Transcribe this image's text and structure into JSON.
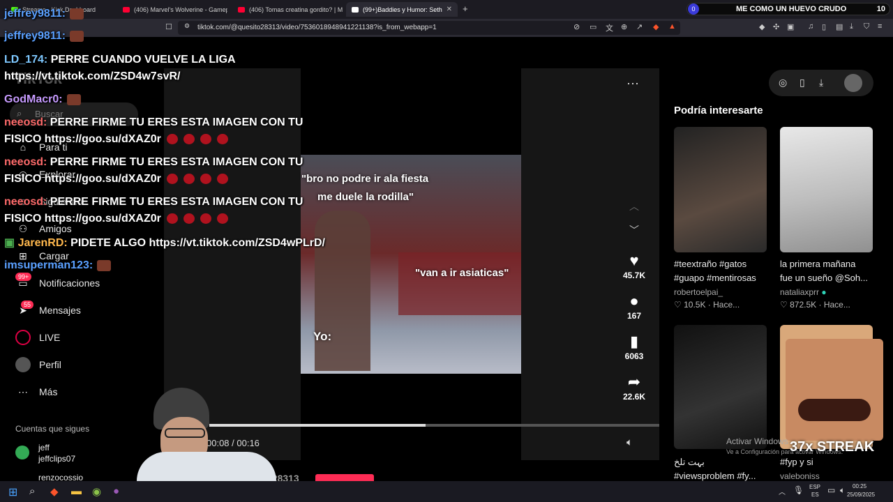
{
  "tabs": [
    {
      "label": "Streams - Kick Dashboard",
      "color": "#53fc18"
    },
    {
      "label": "(406) Marvel's Wolverine - Gameplay",
      "color": "#ff0033"
    },
    {
      "label": "(406) Tomas creatina gordito? | Mom",
      "color": "#ff0033"
    },
    {
      "label": "(99+)Baddies y Humor: Seth F",
      "color": "#ffffff"
    }
  ],
  "new_tab": "+",
  "brave_pill": {
    "count": "0",
    "label": "ME COMO UN HUEVO CRUDO",
    "number": "10"
  },
  "url": "tiktok.com/@quesito28313/video/7536018948941221138?is_from_webapp=1",
  "chat": [
    {
      "user": "jeffrey9811:",
      "color": "#5aa0ff",
      "text": ""
    },
    {
      "user": "jeffrey9811:",
      "color": "#5aa0ff",
      "text": ""
    },
    {
      "user": "LD_174:",
      "color": "#7ec8ff",
      "text": "PERRE CUANDO VUELVE LA LIGA"
    },
    {
      "user": "",
      "color": "#ffffff",
      "text": "https://vt.tiktok.com/ZSD4w7svR/"
    },
    {
      "user": "GodMacr0:",
      "color": "#c79bff",
      "text": ""
    },
    {
      "user": "neeosd:",
      "color": "#ff6b6b",
      "text": "PERRE FIRME TU ERES ESTA IMAGEN CON TU"
    },
    {
      "user": "",
      "color": "#ffffff",
      "text": "FISICO https://goo.su/dXAZ0r"
    },
    {
      "user": "neeosd:",
      "color": "#ff6b6b",
      "text": "PERRE FIRME TU ERES ESTA IMAGEN CON TU"
    },
    {
      "user": "",
      "color": "#ffffff",
      "text": "FISICO https://goo.su/dXAZ0r"
    },
    {
      "user": "neeosd:",
      "color": "#ff6b6b",
      "text": "PERRE FIRME TU ERES ESTA IMAGEN CON TU"
    },
    {
      "user": "",
      "color": "#ffffff",
      "text": "FISICO https://goo.su/dXAZ0r"
    },
    {
      "user": "JarenRD:",
      "color": "#ffb84d",
      "text": "PIDETE ALGO https://vt.tiktok.com/ZSD4wPLrD/"
    },
    {
      "user": "imsuperman123:",
      "color": "#5aa0ff",
      "text": ""
    }
  ],
  "nav": {
    "brand": "TikTok",
    "search": "Buscar",
    "items": [
      "Para ti",
      "Explorar",
      "Siguiendo",
      "Amigos",
      "Cargar",
      "Notificaciones",
      "Mensajes",
      "LIVE",
      "Perfil",
      "Más"
    ],
    "notif_badge": "99+",
    "msg_badge": "55",
    "following_title": "Cuentas que sigues",
    "following": [
      {
        "name": "jeff",
        "handle": "jeffclips07"
      },
      {
        "name": "renzocossio",
        "handle": ""
      }
    ]
  },
  "video": {
    "caption1": "\"bro no podre ir ala fiesta",
    "caption2": "me duele la rodilla\"",
    "caption3": "\"van a ir asiaticas\"",
    "caption4": "Yo:",
    "time": "00:08 / 00:16",
    "author": "quesito28313",
    "progress": 0.48
  },
  "actions": {
    "likes": "45.7K",
    "comments": "167",
    "saves": "6063",
    "shares": "22.6K"
  },
  "right": {
    "title": "Podría interesarte",
    "cards": [
      {
        "caption": "#teextraño #gatos",
        "caption2": "#guapo #mentirosas",
        "user": "robertoelpai_",
        "likes": "10.5K",
        "time": "Hace..."
      },
      {
        "caption": "la primera mañana",
        "caption2": "fue un sueño @Soh...",
        "user": "nataliaxprr",
        "likes": "872.5K",
        "time": "Hace..."
      },
      {
        "caption": "بہت تلخ",
        "caption2": "#viewsproblem #fy...",
        "user": "",
        "likes": "",
        "time": ""
      },
      {
        "caption": "#fyp y si",
        "caption2": "",
        "user": "valeboniss",
        "likes": "",
        "time": ""
      }
    ]
  },
  "overlay": {
    "streak": "37x STREAK",
    "activate": "Activar Windows",
    "activate_sub": "Ve a Configuración para activar Windows."
  },
  "taskbar": {
    "lang": "ESP",
    "lang2": "ES",
    "time": "00:25",
    "date": "25/09/2025"
  }
}
